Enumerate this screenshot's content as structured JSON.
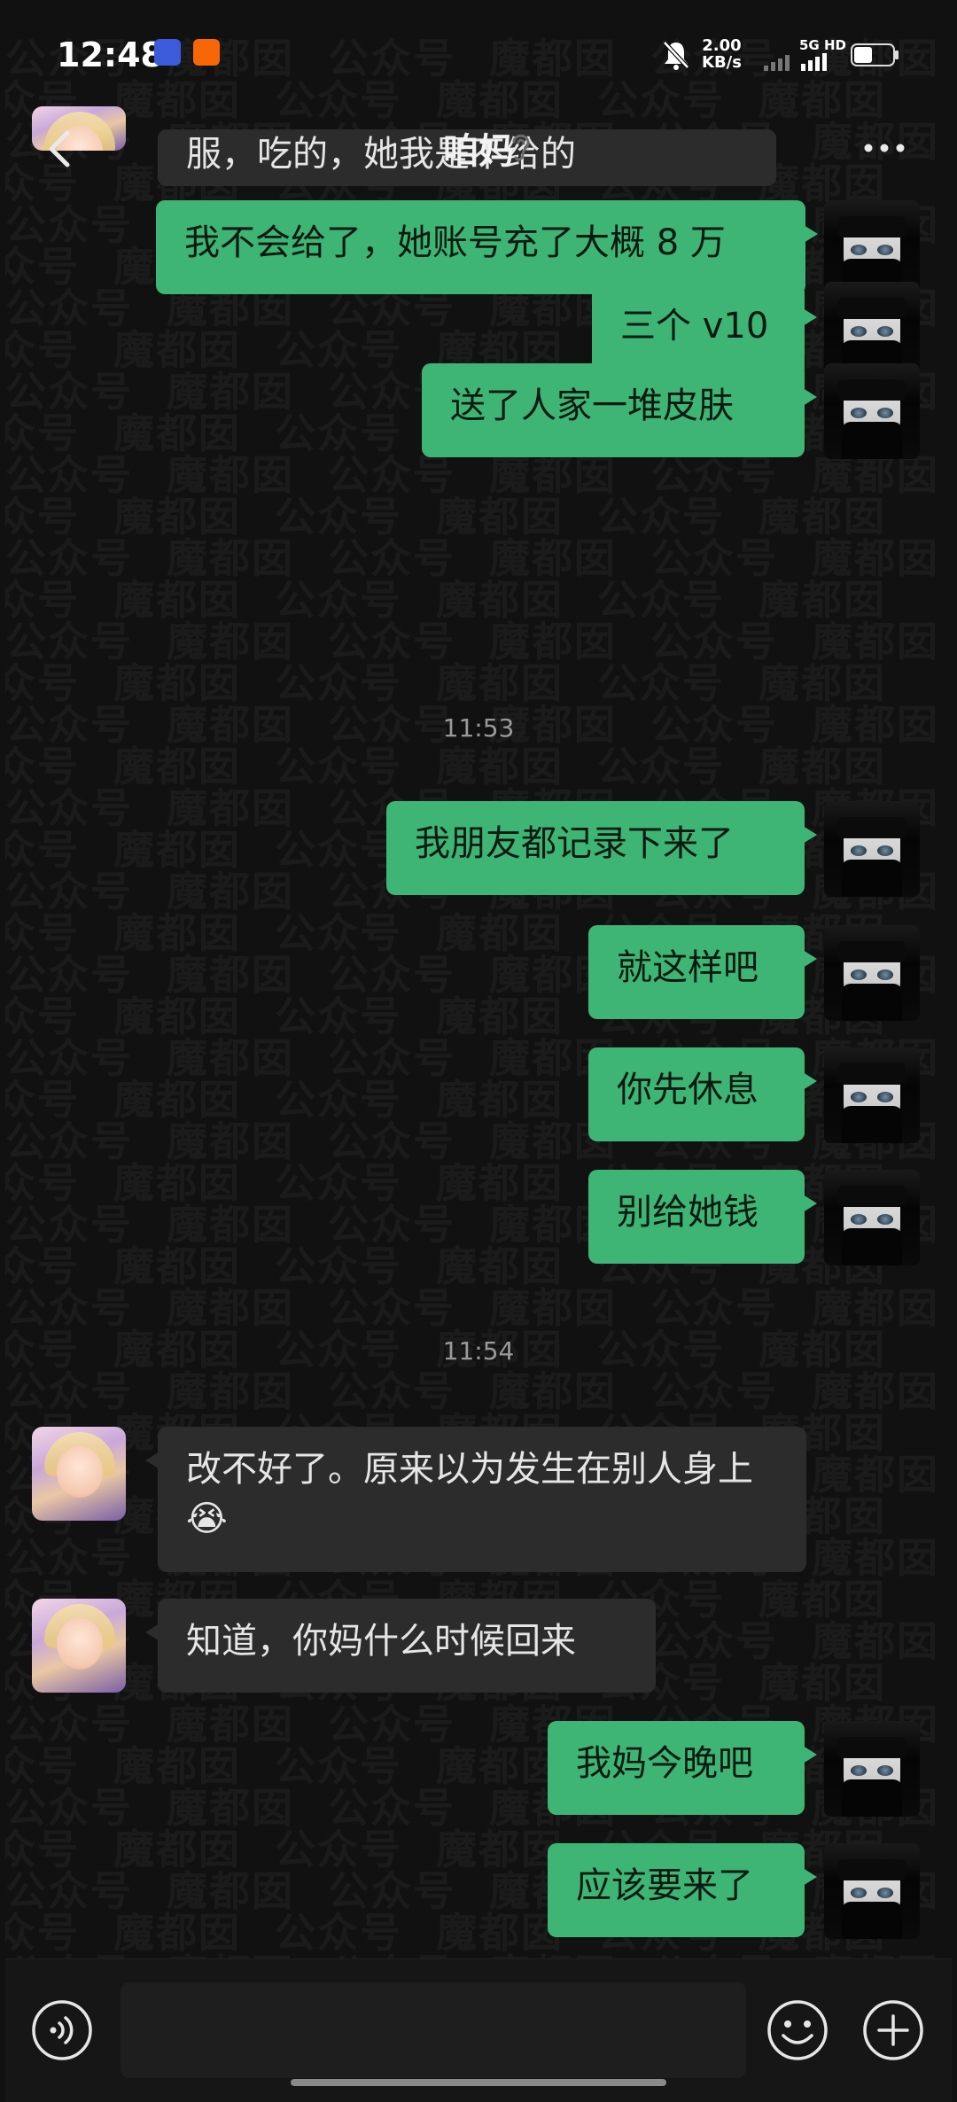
{
  "status_bar": {
    "time": "12:48",
    "net_speed_value": "2.00",
    "net_speed_unit": "KB/s",
    "network_type": "5G HD",
    "battery_icon": "battery-icon",
    "mute_icon": "bell-off-icon"
  },
  "header": {
    "title": "咱妈",
    "back_icon": "chevron-left-icon",
    "ear_icon": "ear-icon",
    "more_icon": "more-dots-icon"
  },
  "watermark": {
    "words": [
      "公众号",
      "魔都囡"
    ]
  },
  "messages": [
    {
      "from": "friend",
      "text": "服，吃的，她我是不给的"
    },
    {
      "from": "me",
      "text": "我不会给了，她账号充了大概 8 万"
    },
    {
      "from": "me",
      "text": "三个 v10"
    },
    {
      "from": "me",
      "text": "送了人家一堆皮肤"
    },
    {
      "type": "time",
      "text": "11:53"
    },
    {
      "from": "me",
      "text": "我朋友都记录下来了"
    },
    {
      "from": "me",
      "text": "就这样吧"
    },
    {
      "from": "me",
      "text": "你先休息"
    },
    {
      "from": "me",
      "text": "别给她钱"
    },
    {
      "type": "time",
      "text": "11:54"
    },
    {
      "from": "friend",
      "text": "改不好了。原来以为发生在别人身上😭"
    },
    {
      "from": "friend",
      "text": "知道，你妈什么时候回来"
    },
    {
      "from": "me",
      "text": "我妈今晚吧"
    },
    {
      "from": "me",
      "text": "应该要来了"
    }
  ],
  "input_bar": {
    "placeholder": "",
    "voice_icon": "voice-icon",
    "emoji_icon": "emoji-icon",
    "plus_icon": "plus-icon"
  },
  "colors": {
    "background": "#111111",
    "outgoing_bubble": "#3eb575",
    "incoming_bubble": "#2c2c2c",
    "timestamp": "#9a9a9a"
  }
}
